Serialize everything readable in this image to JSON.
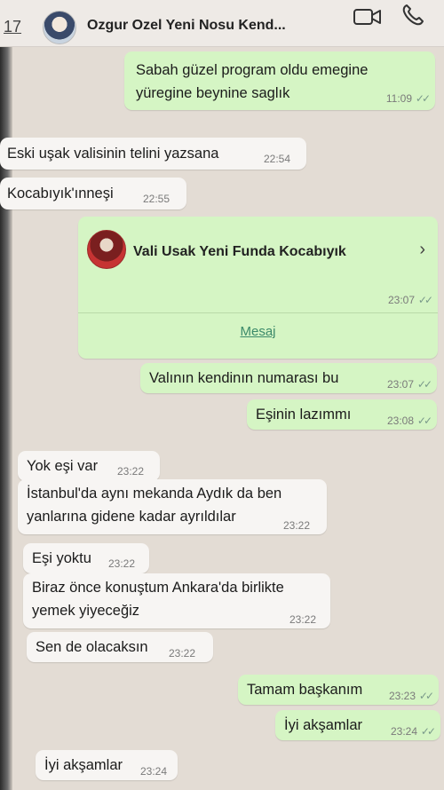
{
  "header": {
    "back_count": "17",
    "contact_name": "Ozgur Ozel Yeni Nosu Kend..."
  },
  "messages": {
    "m1": {
      "line1": "Sabah güzel program oldu emegine",
      "line2": "yüregine beynine saglık",
      "time": "11:09"
    },
    "m2": {
      "text": "Eski uşak valisinin telini yazsana",
      "time": "22:54"
    },
    "m3": {
      "text": "Kocabıyık'ınneşi",
      "time": "22:55"
    },
    "m4": {
      "contact_name": "Vali Usak Yeni Funda Kocabıyık",
      "time": "23:07",
      "action": "Mesaj"
    },
    "m5": {
      "text": "Valının kendinın numarası bu",
      "time": "23:07"
    },
    "m6": {
      "text": "Eşinin lazımmı",
      "time": "23:08"
    },
    "m7": {
      "text": "Yok eşi var",
      "time": "23:22"
    },
    "m8": {
      "line1": "İstanbul'da aynı mekanda Aydık da ben",
      "line2": "yanlarına gidene kadar ayrıldılar",
      "time": "23:22"
    },
    "m9": {
      "text": "Eşi yoktu",
      "time": "23:22"
    },
    "m10": {
      "line1": "Biraz önce konuştum Ankara'da birlikte",
      "line2": "yemek yiyeceğiz",
      "time": "23:22"
    },
    "m11": {
      "text": "Sen de olacaksın",
      "time": "23:22"
    },
    "m12": {
      "text": "Tamam başkanım",
      "time": "23:23"
    },
    "m13": {
      "text": "İyi akşamlar",
      "time": "23:24"
    },
    "m14": {
      "text": "İyi akşamlar",
      "time": "23:24"
    }
  },
  "icons": {
    "video": "video-call-icon",
    "phone": "voice-call-icon",
    "read": "double-check-icon"
  },
  "colors": {
    "incoming": "#f7f5f3",
    "outgoing": "#d5f5c4",
    "header": "#eeeae6",
    "link": "#3c8a6a"
  }
}
